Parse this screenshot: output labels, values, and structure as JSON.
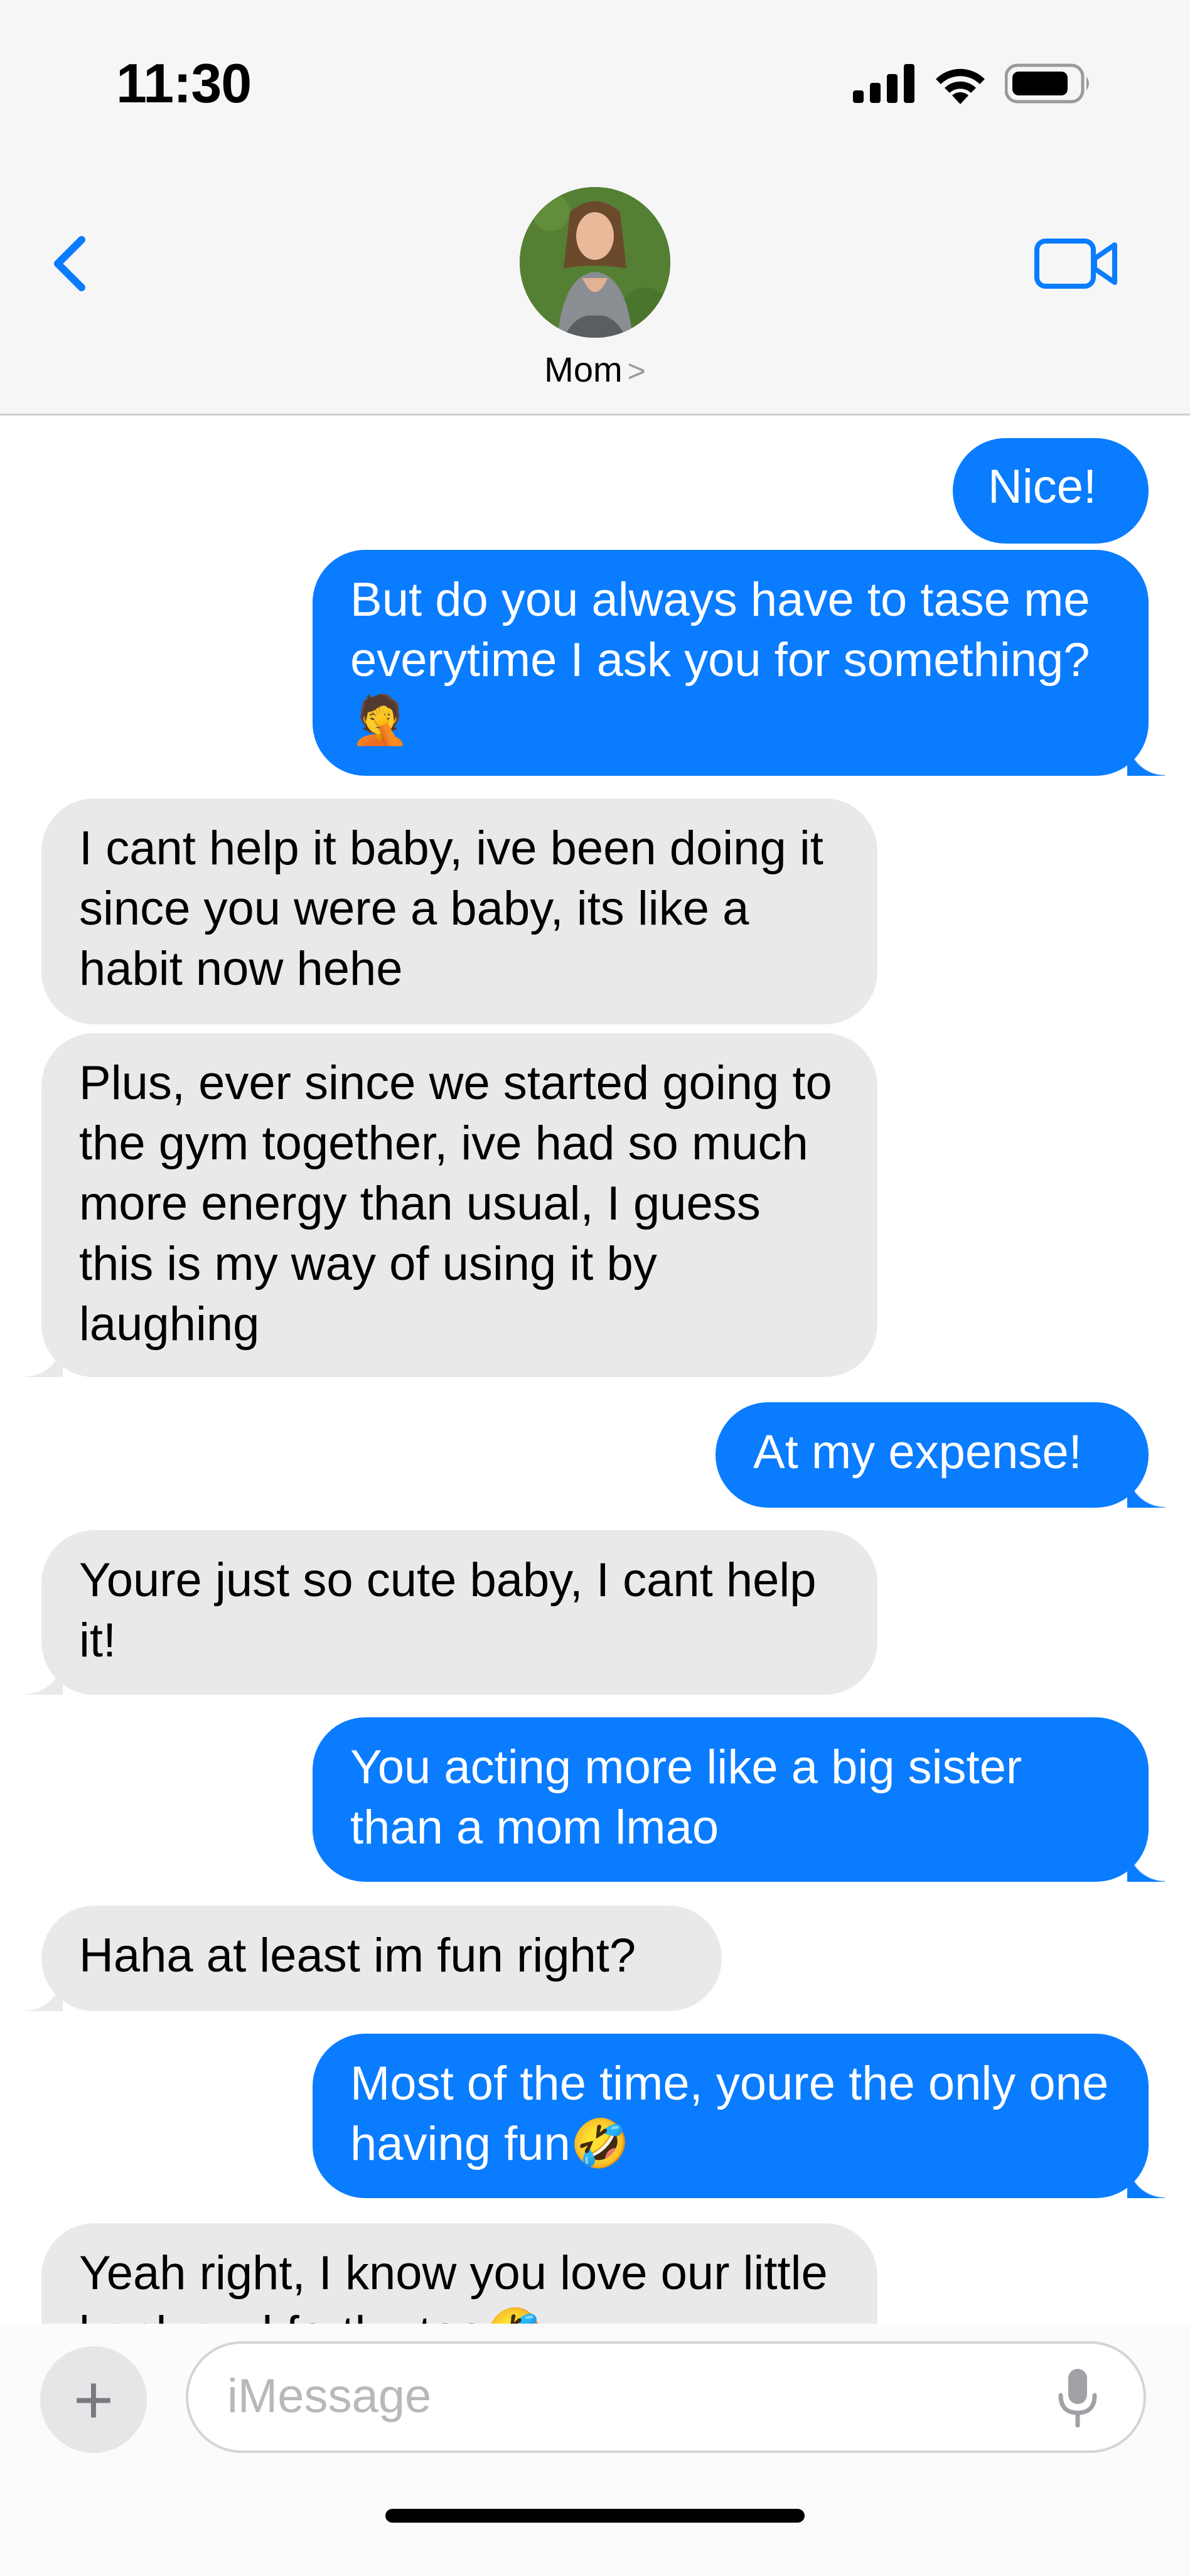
{
  "status_bar": {
    "time": "11:30"
  },
  "header": {
    "contact_name": "Mom",
    "chevron": ">"
  },
  "messages": [
    {
      "from": "me",
      "text": "Nice!"
    },
    {
      "from": "me",
      "text": "But do you always have to tase me everytime I ask you for something?🤦"
    },
    {
      "from": "them",
      "text": "I cant help it baby, ive been doing it since you were a baby, its like a habit now hehe"
    },
    {
      "from": "them",
      "text": "Plus, ever since we started going to the gym together, ive had so much more energy than usual, I guess this is my way of using it by laughing"
    },
    {
      "from": "me",
      "text": "At my expense!"
    },
    {
      "from": "them",
      "text": "Youre just so cute baby, I cant help it!"
    },
    {
      "from": "me",
      "text": "You acting more like a big sister than a mom lmao"
    },
    {
      "from": "them",
      "text": "Haha at least im fun right?"
    },
    {
      "from": "me",
      "text": "Most of the time, youre the only one having fun🤣"
    },
    {
      "from": "them",
      "text": "Yeah right, I know you love our little back and forths too🤣"
    }
  ],
  "input": {
    "placeholder": "iMessage",
    "plus": "+"
  },
  "colors": {
    "sent_bubble": "#0a7cff",
    "received_bubble": "#e9e9eb",
    "accent": "#0a7cff"
  },
  "icons": [
    "back-chevron-icon",
    "video-camera-icon",
    "signal-icon",
    "wifi-icon",
    "battery-icon",
    "plus-icon",
    "microphone-icon"
  ]
}
